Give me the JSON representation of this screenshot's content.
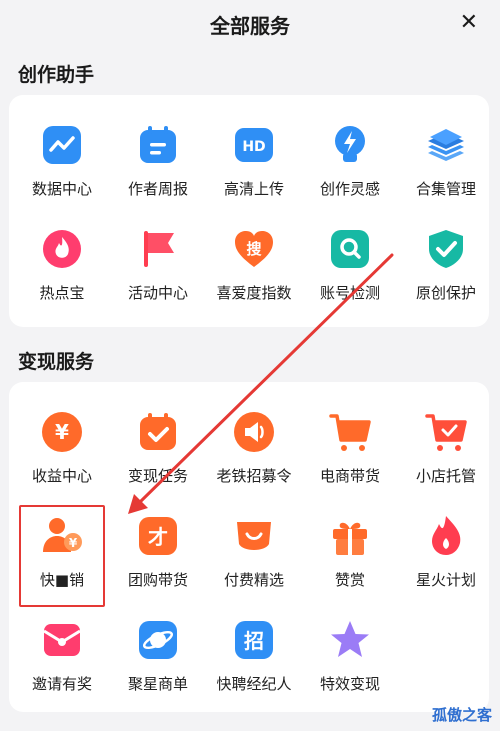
{
  "header": {
    "title": "全部服务",
    "close_glyph": "✕"
  },
  "sections": [
    {
      "title": "创作助手",
      "items": [
        {
          "label": "数据中心",
          "icon": "chart-icon"
        },
        {
          "label": "作者周报",
          "icon": "calendar-icon"
        },
        {
          "label": "高清上传",
          "icon": "hd-icon"
        },
        {
          "label": "创作灵感",
          "icon": "bulb-icon"
        },
        {
          "label": "合集管理",
          "icon": "layers-icon"
        },
        {
          "label": "热点宝",
          "icon": "flame-icon"
        },
        {
          "label": "活动中心",
          "icon": "flag-icon"
        },
        {
          "label": "喜爱度指数",
          "icon": "heart-icon",
          "glyph": "搜"
        },
        {
          "label": "账号检测",
          "icon": "search-shield-icon"
        },
        {
          "label": "原创保护",
          "icon": "shield-check-icon"
        }
      ]
    },
    {
      "title": "变现服务",
      "items": [
        {
          "label": "收益中心",
          "icon": "yuan-icon",
          "glyph": "¥"
        },
        {
          "label": "变现任务",
          "icon": "task-icon"
        },
        {
          "label": "老铁招募令",
          "icon": "megaphone-icon"
        },
        {
          "label": "电商带货",
          "icon": "cart-icon"
        },
        {
          "label": "小店托管",
          "icon": "cart-check-icon"
        },
        {
          "label": "快■销",
          "icon": "user-yuan-icon",
          "glyph": "¥"
        },
        {
          "label": "团购带货",
          "icon": "group-buy-icon",
          "glyph": "才"
        },
        {
          "label": "付费精选",
          "icon": "smile-icon"
        },
        {
          "label": "赞赏",
          "icon": "gift-icon"
        },
        {
          "label": "星火计划",
          "icon": "fire-icon"
        },
        {
          "label": "邀请有奖",
          "icon": "invite-icon"
        },
        {
          "label": "聚星商单",
          "icon": "planet-icon"
        },
        {
          "label": "快聘经纪人",
          "icon": "recruit-icon",
          "glyph": "招"
        },
        {
          "label": "特效变现",
          "icon": "star-icon"
        }
      ]
    }
  ],
  "watermark": "孤傲之客",
  "colors": {
    "blue_accent": "#2f8ff5",
    "red_accent": "#ff3d50",
    "orange_accent": "#ff6a2a",
    "annotation": "#e53935"
  }
}
